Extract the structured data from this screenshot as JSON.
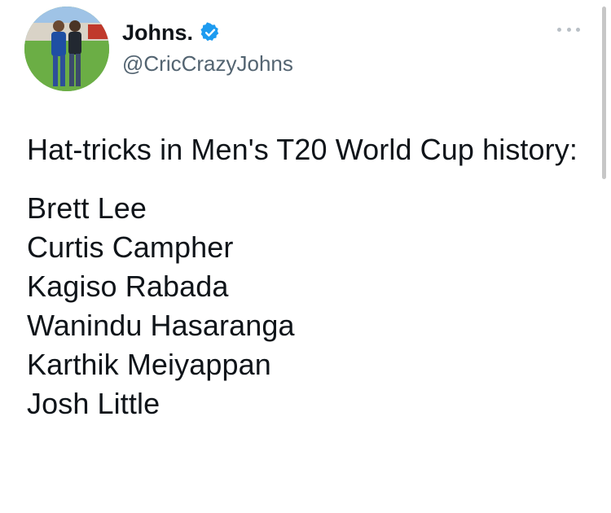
{
  "author": {
    "display_name": "Johns.",
    "handle": "@CricCrazyJohns",
    "verified": true,
    "avatar_icon": "profile-photo"
  },
  "tweet": {
    "intro": "Hat-tricks in Men's T20 World Cup history:",
    "players": [
      "Brett Lee",
      "Curtis Campher",
      "Kagiso Rabada",
      "Wanindu Hasaranga",
      "Karthik Meiyappan",
      "Josh Little"
    ]
  },
  "colors": {
    "text": "#0f1419",
    "secondary": "#536471",
    "verified_badge": "#1d9bf0",
    "more_dots": "#b9c0c6"
  }
}
